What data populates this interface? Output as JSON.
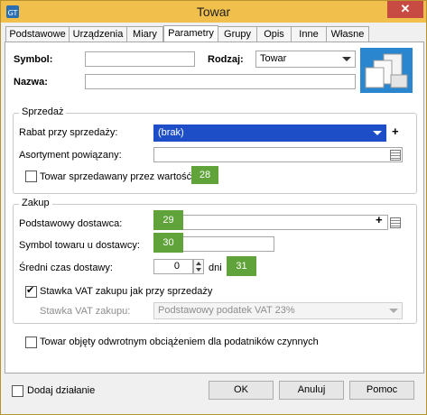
{
  "window": {
    "title": "Towar",
    "close_symbol": "✕"
  },
  "tabs": [
    {
      "label": "Podstawowe"
    },
    {
      "label": "Urządzenia"
    },
    {
      "label": "Miary"
    },
    {
      "label": "Parametry",
      "active": true
    },
    {
      "label": "Grupy"
    },
    {
      "label": "Opis"
    },
    {
      "label": "Inne"
    },
    {
      "label": "Własne"
    }
  ],
  "header": {
    "symbol_label": "Symbol:",
    "symbol_value": "",
    "rodzaj_label": "Rodzaj:",
    "rodzaj_value": "Towar",
    "nazwa_label": "Nazwa:",
    "nazwa_value": ""
  },
  "sprzedaz": {
    "title": "Sprzedaż",
    "rabat_label": "Rabat przy sprzedaży:",
    "rabat_value": "(brak)",
    "asortyment_label": "Asortyment powiązany:",
    "asortyment_value": "",
    "wartosc_label": "Towar sprzedawany przez wartość",
    "wartosc_checked": false,
    "badge": "28"
  },
  "zakup": {
    "title": "Zakup",
    "dostawca_label": "Podstawowy dostawca:",
    "dostawca_badge": "29",
    "symbol_dostawcy_label": "Symbol towaru u dostawcy:",
    "symbol_dostawcy_badge": "30",
    "czas_label": "Średni czas dostawy:",
    "czas_value": "0",
    "czas_unit": "dni",
    "czas_badge": "31",
    "vat_same_label": "Stawka VAT zakupu jak przy sprzedaży",
    "vat_same_checked": true,
    "vat_label": "Stawka VAT zakupu:",
    "vat_value": "Podstawowy podatek VAT 23%"
  },
  "odwrotny": {
    "label": "Towar objęty odwrotnym obciążeniem dla podatników czynnych",
    "checked": false
  },
  "footer": {
    "dodaj_label": "Dodaj działanie",
    "dodaj_checked": false,
    "ok_label": "OK",
    "anuluj_label": "Anuluj",
    "pomoc_label": "Pomoc"
  },
  "colors": {
    "titlebar": "#f0bf4c",
    "close": "#c74b43",
    "selection": "#1e4ec7",
    "badge": "#5fa33a"
  }
}
